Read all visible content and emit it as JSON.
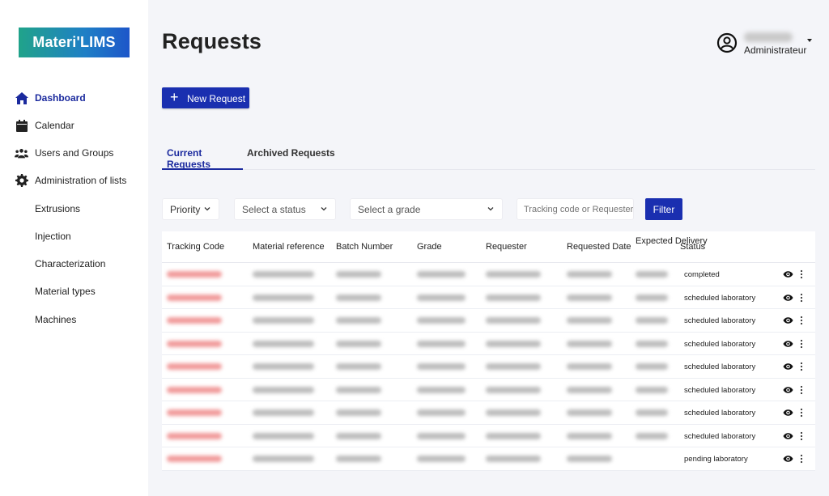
{
  "app": {
    "logo_text": "Materi'LIMS"
  },
  "sidebar": {
    "items": [
      {
        "label": "Dashboard",
        "icon": "home-icon",
        "active": true
      },
      {
        "label": "Calendar",
        "icon": "calendar-icon"
      },
      {
        "label": "Users and Groups",
        "icon": "users-icon"
      },
      {
        "label": "Administration of lists",
        "icon": "gear-icon"
      },
      {
        "label": "Extrusions"
      },
      {
        "label": "Injection"
      },
      {
        "label": "Characterization"
      },
      {
        "label": "Material types"
      },
      {
        "label": "Machines"
      }
    ]
  },
  "header": {
    "title": "Requests",
    "user_role": "Administrateur",
    "user_icon": "account-circle-icon"
  },
  "toolbar": {
    "new_request_label": "New Request"
  },
  "tabs": [
    {
      "label": "Current Requests",
      "active": true
    },
    {
      "label": "Archived Requests"
    }
  ],
  "filters": {
    "priority": "Priority",
    "status_placeholder": "Select a status",
    "grade_placeholder": "Select a grade",
    "search_placeholder": "Tracking code or Requester",
    "filter_label": "Filter"
  },
  "table": {
    "columns": [
      "Tracking Code",
      "Material reference",
      "Batch Number",
      "Grade",
      "Requester",
      "Requested Date",
      "Expected Delivery",
      "Status"
    ],
    "rows": [
      {
        "status": "completed"
      },
      {
        "status": "scheduled laboratory"
      },
      {
        "status": "scheduled laboratory"
      },
      {
        "status": "scheduled laboratory"
      },
      {
        "status": "scheduled laboratory"
      },
      {
        "status": "scheduled laboratory"
      },
      {
        "status": "scheduled laboratory"
      },
      {
        "status": "scheduled laboratory"
      },
      {
        "status": "pending laboratory"
      }
    ]
  },
  "colors": {
    "accent": "#1a2fb0",
    "active_nav": "#1b2a9e",
    "tracking_code": "#e85a5a"
  }
}
